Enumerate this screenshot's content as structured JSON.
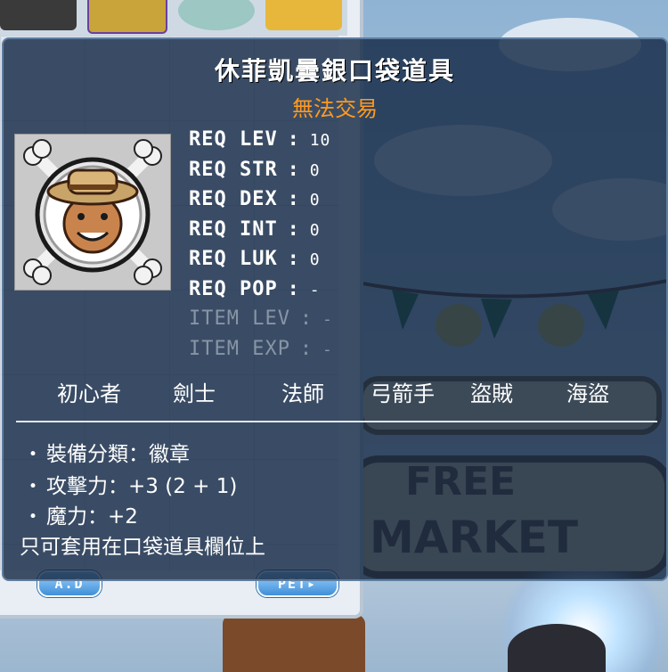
{
  "item": {
    "name": "休菲凱曇銀口袋道具",
    "trade_status": "無法交易",
    "icon": "pocket-item-icon",
    "requirements": [
      {
        "label": "REQ LEV",
        "value": "10",
        "dim": false
      },
      {
        "label": "REQ STR",
        "value": "0",
        "dim": false
      },
      {
        "label": "REQ DEX",
        "value": "0",
        "dim": false
      },
      {
        "label": "REQ INT",
        "value": "0",
        "dim": false
      },
      {
        "label": "REQ LUK",
        "value": "0",
        "dim": false
      },
      {
        "label": "REQ POP",
        "value": "-",
        "dim": false
      },
      {
        "label": "ITEM LEV",
        "value": "-",
        "dim": true
      },
      {
        "label": "ITEM EXP",
        "value": "-",
        "dim": true
      }
    ],
    "jobs": [
      "初心者",
      "劍士",
      "法師",
      "弓箭手",
      "盜賊",
      "海盜"
    ],
    "stats": [
      {
        "bullet": "・",
        "text": "裝備分類：徽章"
      },
      {
        "bullet": "・",
        "text": "攻擊力：+3 (2 + 1)"
      },
      {
        "bullet": "・",
        "text": "魔力：+2"
      }
    ],
    "note": "只可套用在口袋道具欄位上"
  },
  "inventory": {
    "left_button": "A.D",
    "right_button": "PET▸"
  },
  "colors": {
    "tooltip_bg": "#10264a",
    "trade_status": "#ff9a1f",
    "text": "#ffffff",
    "dim_text": "#8795a5"
  }
}
